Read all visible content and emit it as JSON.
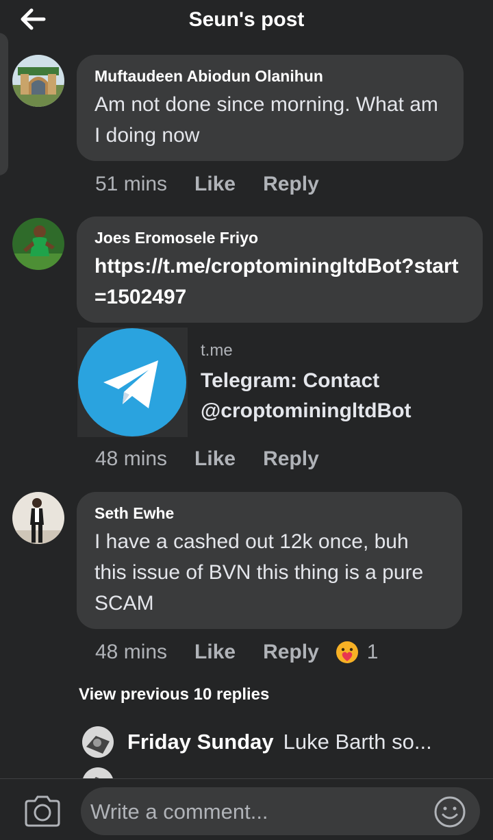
{
  "header": {
    "title": "Seun's post",
    "back_icon": "arrow-left-icon"
  },
  "comments": [
    {
      "author": "Muftaudeen Abiodun Olanihun",
      "text": "Am not done since morning. What am I doing now",
      "time": "51 mins",
      "like": "Like",
      "reply": "Reply"
    },
    {
      "author": "Joes Eromosele Friyo",
      "text": "https://t.me/croptominingltdBot?start=1502497",
      "time": "48 mins",
      "like": "Like",
      "reply": "Reply",
      "preview": {
        "domain": "t.me",
        "title": "Telegram: Contact @croptominingltdBot",
        "icon": "telegram-icon",
        "accent": "#2aa3df"
      }
    },
    {
      "author": "Seth Ewhe",
      "text": "I have a cashed out 12k once, buh this issue of BVN this thing is a pure SCAM",
      "time": "48 mins",
      "like": "Like",
      "reply": "Reply",
      "reaction": {
        "icon": "care-reaction-icon",
        "count": "1"
      }
    }
  ],
  "view_previous": "View previous 10 replies",
  "latest_reply": {
    "name": "Friday Sunday",
    "text": "Luke Barth so..."
  },
  "composer": {
    "placeholder": "Write a comment...",
    "camera_icon": "camera-icon",
    "emoji_icon": "smiley-icon"
  },
  "colors": {
    "background": "#242526",
    "bubble": "#3a3b3c",
    "muted": "#b0b3b8",
    "text": "#e4e6eb"
  }
}
